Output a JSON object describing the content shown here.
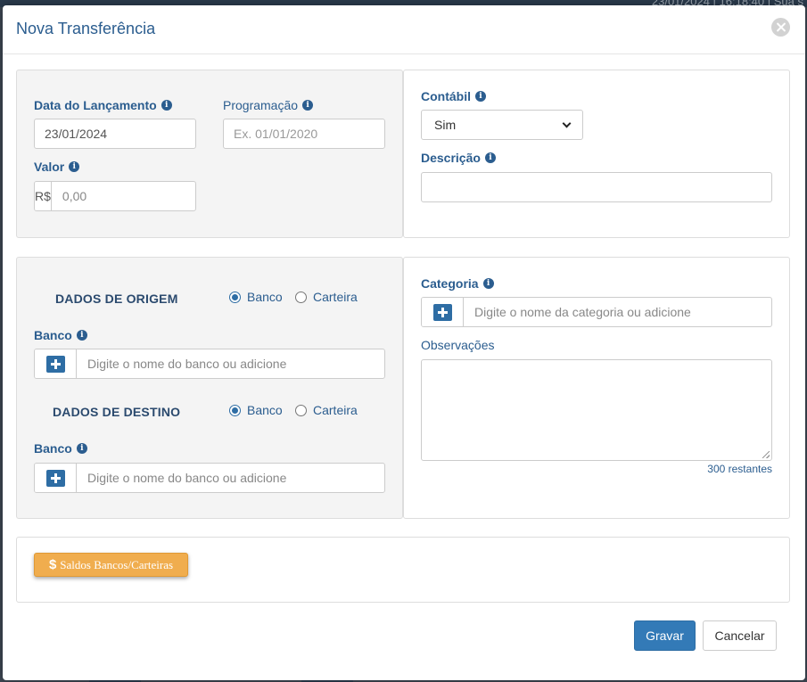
{
  "background": {
    "top_text": "23/01/2024  |  16:18:40  |  Sua s"
  },
  "modal": {
    "title": "Nova Transferência"
  },
  "date_panel": {
    "data_lancamento": {
      "label": "Data do Lançamento",
      "value": "23/01/2024"
    },
    "programacao": {
      "label": "Programação",
      "placeholder": "Ex. 01/01/2020"
    },
    "valor": {
      "label": "Valor",
      "prefix": "R$",
      "placeholder": "0,00"
    }
  },
  "info_panel": {
    "contabil": {
      "label": "Contábil",
      "selected": "Sim"
    },
    "descricao": {
      "label": "Descrição",
      "value": ""
    }
  },
  "origem": {
    "title": "DADOS DE ORIGEM",
    "radio_banco": "Banco",
    "radio_carteira": "Carteira",
    "selected": "Banco",
    "banco_label": "Banco",
    "banco_placeholder": "Digite o nome do banco ou adicione"
  },
  "destino": {
    "title": "DADOS DE DESTINO",
    "radio_banco": "Banco",
    "radio_carteira": "Carteira",
    "selected": "Banco",
    "banco_label": "Banco",
    "banco_placeholder": "Digite o nome do banco ou adicione"
  },
  "categoria": {
    "label": "Categoria",
    "placeholder": "Digite o nome da categoria ou adicione"
  },
  "observacoes": {
    "label": "Observações",
    "value": "",
    "counter": "300 restantes"
  },
  "saldos_button": {
    "label": "Saldos Bancos/Carteiras"
  },
  "footer": {
    "save": "Gravar",
    "cancel": "Cancelar"
  },
  "colors": {
    "primary": "#337ab7",
    "label": "#2b5d8f",
    "warning": "#f0ad4e"
  }
}
